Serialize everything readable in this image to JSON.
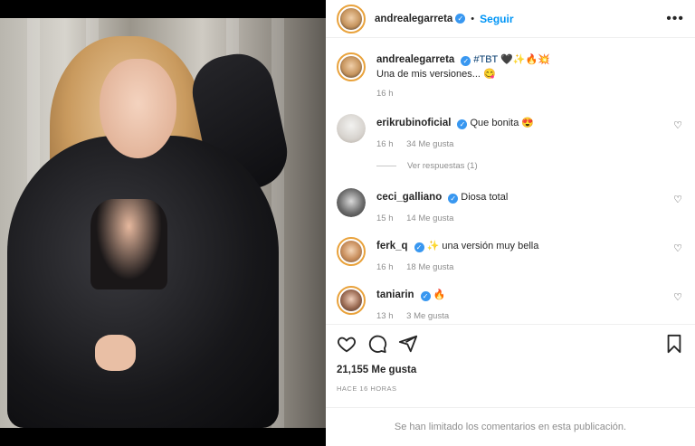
{
  "post": {
    "author": "andrealegarreta",
    "follow_label": "Seguir",
    "more_label": "•••",
    "caption_tag": "#TBT",
    "caption_emojis": "🖤✨🔥💥",
    "caption_text": "Una de mis versiones... 😋",
    "caption_time": "16 h"
  },
  "comments": [
    {
      "user": "erikrubinoficial",
      "text": "Que bonita 😍",
      "time": "16 h",
      "likes": "34 Me gusta"
    },
    {
      "user": "ceci_galliano",
      "text": "Diosa total",
      "time": "15 h",
      "likes": "14 Me gusta"
    },
    {
      "user": "ferk_q",
      "text": "✨ una versión muy bella",
      "time": "16 h",
      "likes": "18 Me gusta"
    },
    {
      "user": "taniarin",
      "text": "🔥",
      "time": "13 h",
      "likes": "3 Me gusta"
    }
  ],
  "replies_label": "Ver respuestas (1)",
  "likes_count": "21,155 Me gusta",
  "time_ago": "HACE 16 HORAS",
  "comments_limited": "Se han limitado los comentarios en esta publicación.",
  "icons": {
    "verified": "verified-badge-icon",
    "like": "heart-icon",
    "comment": "comment-icon",
    "share": "share-icon",
    "save": "bookmark-icon"
  },
  "colors": {
    "accent": "#0095f6",
    "verified": "#3897f0",
    "muted": "#8e8e8e"
  }
}
